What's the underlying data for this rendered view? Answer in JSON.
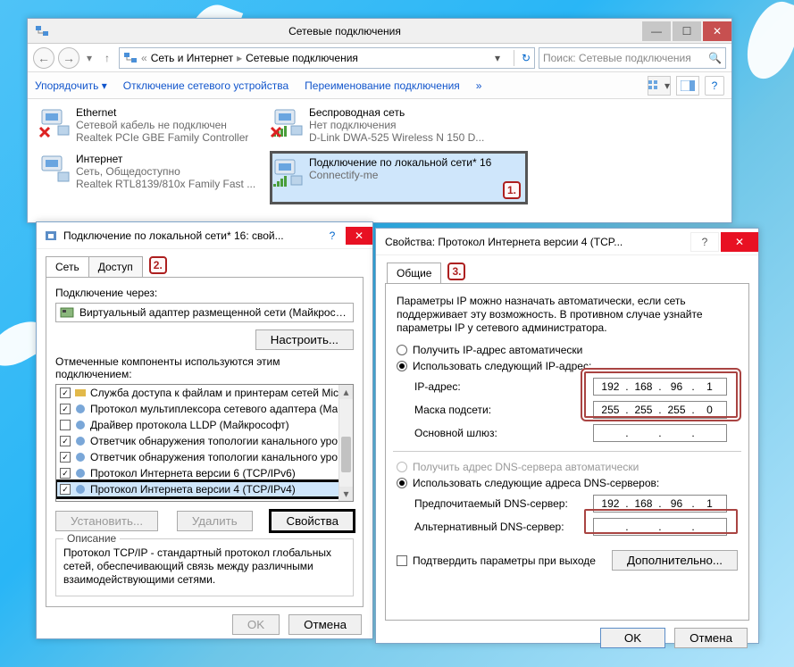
{
  "main": {
    "title": "Сетевые подключения",
    "breadcrumb": {
      "a": "Сеть и Интернет",
      "b": "Сетевые подключения"
    },
    "search_placeholder": "Поиск: Сетевые подключения",
    "commands": {
      "arrange": "Упорядочить",
      "disable": "Отключение сетевого устройства",
      "rename": "Переименование подключения"
    },
    "connections": [
      {
        "name": "Ethernet",
        "sub1": "Сетевой кабель не подключен",
        "sub2": "Realtek PCIe GBE Family Controller",
        "state": "x"
      },
      {
        "name": "Беспроводная сеть",
        "sub1": "Нет подключения",
        "sub2": "D-Link DWA-525 Wireless N 150 D...",
        "state": "wifi-x"
      },
      {
        "name": "Интернет",
        "sub1": "Сеть, Общедоступно",
        "sub2": "Realtek RTL8139/810x Family Fast ...",
        "state": "ok"
      },
      {
        "name": "Подключение по локальной сети* 16",
        "sub1": "",
        "sub2": "Connectify-me",
        "state": "sel"
      }
    ],
    "markers": {
      "m1": "1."
    }
  },
  "props": {
    "title": "Подключение по локальной сети* 16: свой...",
    "tabs": {
      "net": "Сеть",
      "access": "Доступ"
    },
    "conn_via_lbl": "Подключение через:",
    "conn_via_value": "Виртуальный адаптер размещенной сети (Майкрософ",
    "configure_btn": "Настроить...",
    "compo_lbl": "Отмеченные компоненты используются этим подключением:",
    "components": [
      {
        "c": true,
        "t": "Служба доступа к файлам и принтерам сетей Micro"
      },
      {
        "c": true,
        "t": "Протокол мультиплексора сетевого адаптера (Ма"
      },
      {
        "c": false,
        "t": "Драйвер протокола LLDP (Майкрософт)"
      },
      {
        "c": true,
        "t": "Ответчик обнаружения топологии канального уро"
      },
      {
        "c": true,
        "t": "Ответчик обнаружения топологии канального уро"
      },
      {
        "c": true,
        "t": "Протокол Интернета версии 6 (TCP/IPv6)"
      },
      {
        "c": true,
        "t": "Протокол Интернета версии 4 (TCP/IPv4)",
        "sel": true
      }
    ],
    "btns": {
      "install": "Установить...",
      "remove": "Удалить",
      "properties": "Свойства"
    },
    "desc_lbl": "Описание",
    "desc_text": "Протокол TCP/IP - стандартный протокол глобальных сетей, обеспечивающий связь между различными взаимодействующими сетями.",
    "ok": "OK",
    "cancel": "Отмена",
    "markers": {
      "m2": "2."
    }
  },
  "ipv4": {
    "title": "Свойства: Протокол Интернета версии 4 (TCP...",
    "tab": "Общие",
    "intro": "Параметры IP можно назначать автоматически, если сеть поддерживает эту возможность. В противном случае узнайте параметры IP у сетевого администратора.",
    "r_auto_ip": "Получить IP-адрес автоматически",
    "r_use_ip": "Использовать следующий IP-адрес:",
    "ip_lbl": "IP-адрес:",
    "ip_val": [
      "192",
      "168",
      "96",
      "1"
    ],
    "mask_lbl": "Маска подсети:",
    "mask_val": [
      "255",
      "255",
      "255",
      "0"
    ],
    "gw_lbl": "Основной шлюз:",
    "gw_val": [
      "",
      "",
      "",
      ""
    ],
    "r_auto_dns": "Получить адрес DNS-сервера автоматически",
    "r_use_dns": "Использовать следующие адреса DNS-серверов:",
    "dns1_lbl": "Предпочитаемый DNS-сервер:",
    "dns1_val": [
      "192",
      "168",
      "96",
      "1"
    ],
    "dns2_lbl": "Альтернативный DNS-сервер:",
    "dns2_val": [
      "",
      "",
      "",
      ""
    ],
    "confirm": "Подтвердить параметры при выходе",
    "adv": "Дополнительно...",
    "ok": "OK",
    "cancel": "Отмена",
    "markers": {
      "m3": "3."
    }
  }
}
